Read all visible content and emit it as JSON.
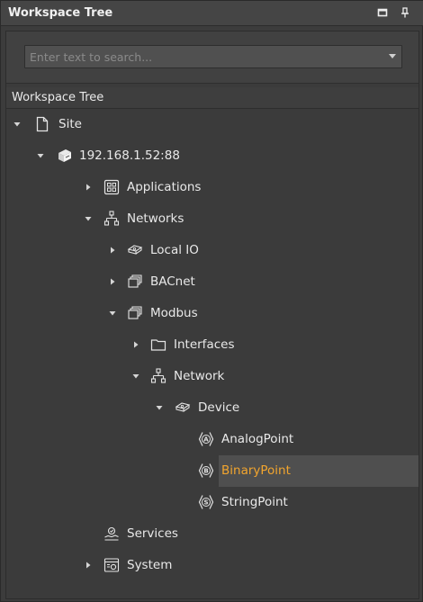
{
  "panel": {
    "title": "Workspace Tree"
  },
  "search": {
    "placeholder": "Enter text to search..."
  },
  "tree_header": "Workspace Tree",
  "tree": [
    {
      "label": "Site",
      "icon": "file-icon",
      "expanded": true
    },
    {
      "label": "192.168.1.52:88",
      "icon": "server-icon",
      "expanded": true
    },
    {
      "label": "Applications",
      "icon": "applications-icon",
      "expanded": false
    },
    {
      "label": "Networks",
      "icon": "network-icon",
      "expanded": true
    },
    {
      "label": "Local IO",
      "icon": "device-icon",
      "expanded": false
    },
    {
      "label": "BACnet",
      "icon": "stack-icon",
      "expanded": false
    },
    {
      "label": "Modbus",
      "icon": "stack-icon",
      "expanded": true
    },
    {
      "label": "Interfaces",
      "icon": "folder-icon",
      "expanded": false
    },
    {
      "label": "Network",
      "icon": "network-icon",
      "expanded": true
    },
    {
      "label": "Device",
      "icon": "device-icon",
      "expanded": true
    },
    {
      "label": "AnalogPoint",
      "icon": "analog-point-icon"
    },
    {
      "label": "BinaryPoint",
      "icon": "binary-point-icon",
      "selected": true
    },
    {
      "label": "StringPoint",
      "icon": "string-point-icon"
    },
    {
      "label": "Services",
      "icon": "services-icon"
    },
    {
      "label": "System",
      "icon": "system-icon",
      "expanded": false
    }
  ],
  "colors": {
    "selected_text": "#f2a52e",
    "background": "#3c3c3c",
    "selection": "#4f4f4f"
  }
}
